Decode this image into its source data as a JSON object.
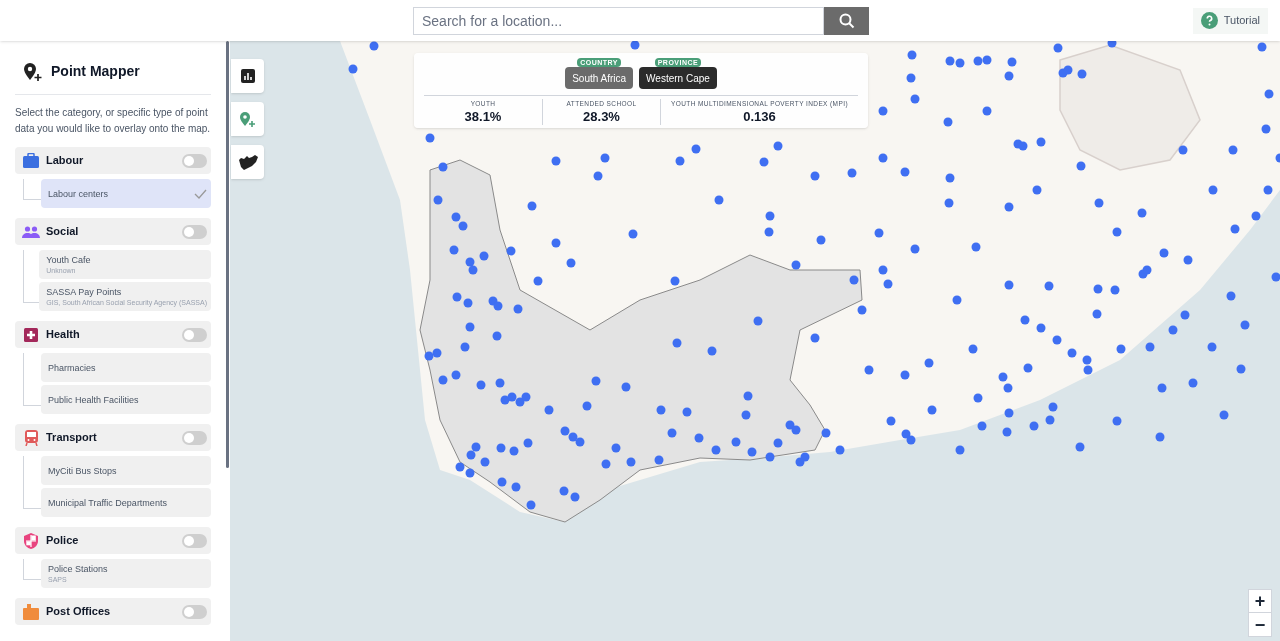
{
  "search": {
    "placeholder": "Search for a location..."
  },
  "tutorial": {
    "label": "Tutorial"
  },
  "sidebar": {
    "title": "Point Mapper",
    "description": "Select the category, or specific type of point data you would like to overlay onto the map.",
    "categories": [
      {
        "kind": "labour",
        "label": "Labour",
        "color": "#3b6fe0",
        "on": false,
        "items": [
          {
            "name": "Labour centers",
            "selected": true
          }
        ]
      },
      {
        "kind": "social",
        "label": "Social",
        "color": "#8b5cf6",
        "on": false,
        "items": [
          {
            "name": "Youth Cafe",
            "source": "Unknown",
            "selected": false
          },
          {
            "name": "SASSA Pay Points",
            "source": "GIS, South African Social Security Agency (SASSA)",
            "selected": false
          }
        ]
      },
      {
        "kind": "health",
        "label": "Health",
        "color": "#a3285a",
        "on": false,
        "items": [
          {
            "name": "Pharmacies",
            "selected": false
          },
          {
            "name": "Public Health Facilities",
            "selected": false
          }
        ]
      },
      {
        "kind": "transport",
        "label": "Transport",
        "color": "#e05a5a",
        "on": false,
        "items": [
          {
            "name": "MyCiti Bus Stops",
            "selected": false
          },
          {
            "name": "Municipal Traffic Departments",
            "selected": false
          }
        ]
      },
      {
        "kind": "police",
        "label": "Police",
        "color": "#e8447f",
        "on": false,
        "items": [
          {
            "name": "Police Stations",
            "source": "SAPS",
            "selected": false
          }
        ]
      },
      {
        "kind": "post",
        "label": "Post Offices",
        "color": "#f08c3c",
        "on": false
      }
    ]
  },
  "info_card": {
    "breadcrumbs": [
      {
        "type": "COUNTRY",
        "name": "South Africa",
        "selected": false
      },
      {
        "type": "PROVINCE",
        "name": "Western Cape",
        "selected": true
      }
    ],
    "stats": [
      {
        "label": "YOUTH",
        "value": "38.1%"
      },
      {
        "label": "ATTENDED SCHOOL",
        "value": "28.3%"
      },
      {
        "label": "YOUTH MULTIDIMENSIONAL POVERTY INDEX (MPI)",
        "value": "0.136"
      }
    ]
  },
  "zoom": {
    "in": "+",
    "out": "−"
  }
}
